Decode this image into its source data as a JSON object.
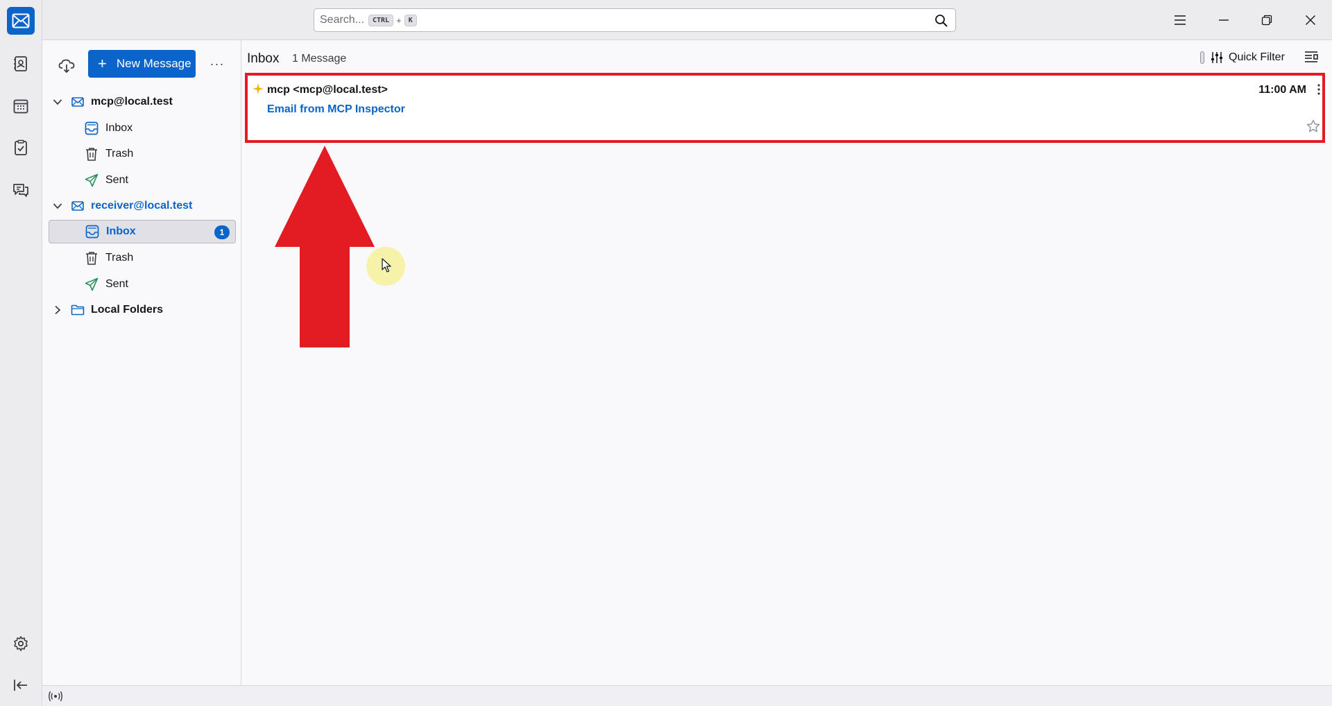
{
  "search": {
    "placeholder": "Search...",
    "shortcut_mod": "CTRL",
    "shortcut_plus": "+",
    "shortcut_key": "K"
  },
  "toolbar": {
    "new_message_label": "New Message",
    "more_label": "···"
  },
  "accounts": [
    {
      "name": "mcp@local.test",
      "folders": [
        {
          "label": "Inbox",
          "icon": "inbox-icon"
        },
        {
          "label": "Trash",
          "icon": "trash-icon"
        },
        {
          "label": "Sent",
          "icon": "sent-icon"
        }
      ]
    },
    {
      "name": "receiver@local.test",
      "folders": [
        {
          "label": "Inbox",
          "icon": "inbox-icon",
          "unread": "1",
          "selected": true
        },
        {
          "label": "Trash",
          "icon": "trash-icon"
        },
        {
          "label": "Sent",
          "icon": "sent-icon"
        }
      ]
    }
  ],
  "local_folders_label": "Local Folders",
  "list": {
    "folder_title": "Inbox",
    "message_count": "1 Message",
    "quick_filter_label": "Quick Filter",
    "messages": [
      {
        "sender": "mcp <mcp@local.test>",
        "subject": "Email from MCP Inspector",
        "date": "11:00 AM"
      }
    ]
  },
  "colors": {
    "accent": "#0b64c9",
    "highlight": "#e31b23",
    "new_star": "#f0b400"
  }
}
